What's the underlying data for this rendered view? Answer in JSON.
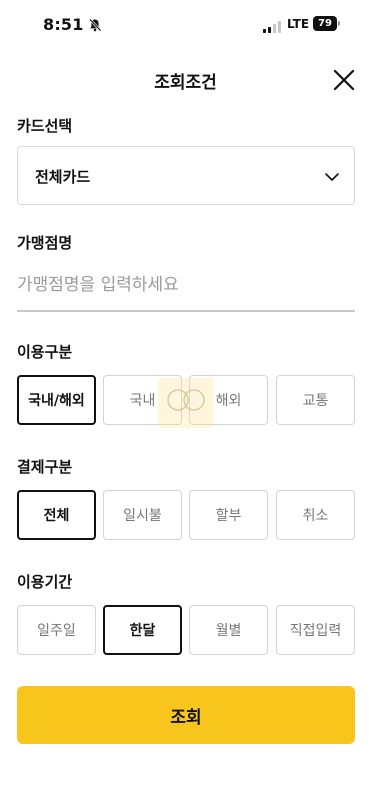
{
  "status_bar": {
    "time": "8:51",
    "network": "LTE",
    "battery": "79"
  },
  "header": {
    "title": "조회조건"
  },
  "card_select": {
    "label": "카드선택",
    "value": "전체카드"
  },
  "merchant": {
    "label": "가맹점명",
    "placeholder": "가맹점명을 입력하세요"
  },
  "usage_type": {
    "label": "이용구분",
    "options": [
      "국내/해외",
      "국내",
      "해외",
      "교통"
    ],
    "selected": "국내/해외"
  },
  "payment_type": {
    "label": "결제구분",
    "options": [
      "전체",
      "일시불",
      "할부",
      "취소"
    ],
    "selected": "전체"
  },
  "period": {
    "label": "이용기간",
    "options": [
      "일주일",
      "한달",
      "월별",
      "직접입력"
    ],
    "selected": "한달"
  },
  "search_button": {
    "label": "조회"
  },
  "colors": {
    "accent": "#f8c51c",
    "border": "#d4d4d4",
    "selected_border": "#111111"
  }
}
